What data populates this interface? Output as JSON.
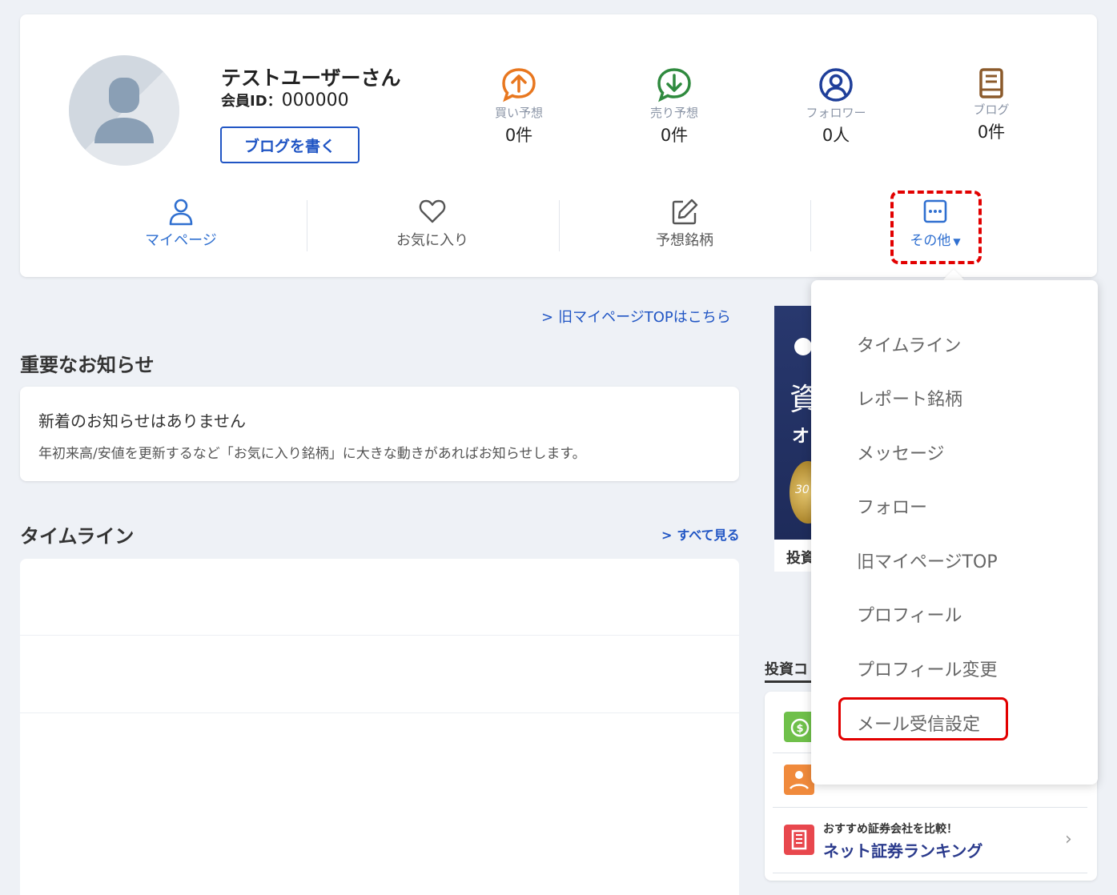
{
  "profile": {
    "user_name": "テストユーザーさん",
    "member_id_label": "会員ID：",
    "member_id": "000000",
    "write_blog_label": "ブログを書く"
  },
  "stats": [
    {
      "label": "買い予想",
      "value": "0件",
      "icon": "arrow-up-circle-icon",
      "color": "#e8771f"
    },
    {
      "label": "売り予想",
      "value": "0件",
      "icon": "arrow-down-circle-icon",
      "color": "#2f8a3e"
    },
    {
      "label": "フォロワー",
      "value": "0人",
      "icon": "user-circle-icon",
      "color": "#1f3f9a"
    },
    {
      "label": "ブログ",
      "value": "0件",
      "icon": "book-icon",
      "color": "#8b5a2b"
    }
  ],
  "nav": [
    {
      "label": "マイページ",
      "icon": "user-icon"
    },
    {
      "label": "お気に入り",
      "icon": "heart-icon"
    },
    {
      "label": "予想銘柄",
      "icon": "edit-icon"
    },
    {
      "label": "その他",
      "icon": "more-icon"
    }
  ],
  "main": {
    "old_top_link": "旧マイページTOPはこちら",
    "notice_heading": "重要なお知らせ",
    "notice_title": "新着のお知らせはありません",
    "notice_desc": "年初来高/安値を更新するなど「お気に入り銘柄」に大きな動きがあればお知らせします。",
    "timeline_heading": "タイムライン",
    "see_all": "すべて見る"
  },
  "right": {
    "banner_char1": "資",
    "banner_char2": "オ",
    "banner_medal_text": "30",
    "banner_caption": "投資",
    "invest_heading": "投資コ",
    "row3_sub": "おすすめ証券会社を比較！",
    "row3_title": "ネット証券ランキング"
  },
  "dropdown": {
    "items": [
      "タイムライン",
      "レポート銘柄",
      "メッセージ",
      "フォロー",
      "旧マイページTOP",
      "プロフィール",
      "プロフィール変更",
      "メール受信設定"
    ]
  },
  "colors": {
    "accent": "#2055c4",
    "highlight": "#e20000"
  }
}
